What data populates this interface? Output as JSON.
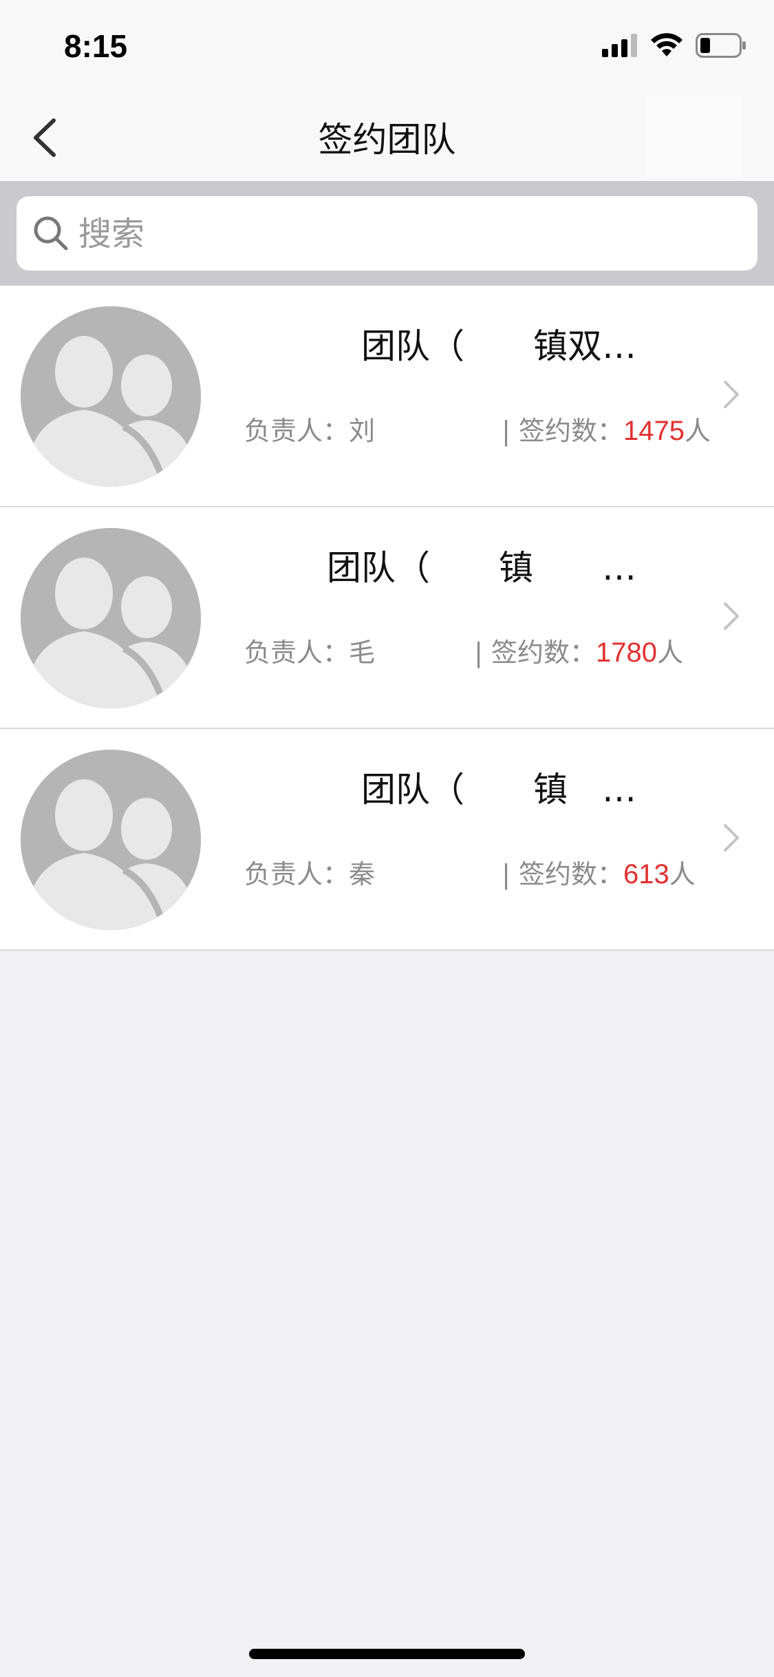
{
  "status_bar": {
    "time": "8:15"
  },
  "nav": {
    "title": "签约团队"
  },
  "search": {
    "placeholder": "搜索"
  },
  "teams": [
    {
      "name": "团队（　　镇双…",
      "leader_label": "负责人：",
      "leader": "刘",
      "sep": "| 签约数：",
      "count": "1475",
      "unit": "人"
    },
    {
      "name": "团队（　　镇　　…",
      "leader_label": "负责人：",
      "leader": "毛",
      "sep": "| 签约数：",
      "count": "1780",
      "unit": "人"
    },
    {
      "name": "团队（　　镇　…",
      "leader_label": "负责人：",
      "leader": "秦",
      "sep": "| 签约数：",
      "count": "613",
      "unit": "人"
    }
  ],
  "colors": {
    "accent_count": "#e23030",
    "avatar_bg": "#b5b5b5",
    "page_bg": "#f0f0f5"
  }
}
